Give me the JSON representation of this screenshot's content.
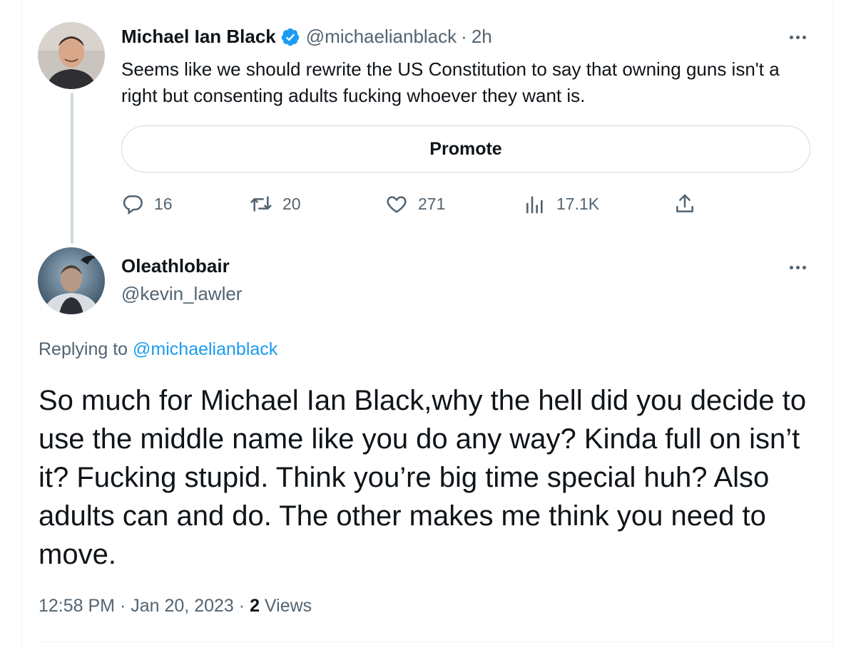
{
  "tweet": {
    "author_name": "Michael Ian Black",
    "author_handle": "@michaelianblack",
    "separator": "·",
    "time_ago": "2h",
    "text": "Seems like we should rewrite the US Constitution to say that owning guns isn't a right but consenting adults fucking whoever they want is.",
    "promote_label": "Promote",
    "stats": {
      "replies": "16",
      "retweets": "20",
      "likes": "271",
      "views": "17.1K"
    },
    "verified": true
  },
  "reply": {
    "author_name": "Oleathlobair",
    "author_handle": "@kevin_lawler",
    "replying_to_label": "Replying to",
    "replying_to_handle": "@michaelianblack",
    "text": "So much for  Michael Ian Black,why the hell did you decide to use the middle name like you do any way? Kinda full on isn’t it? Fucking stupid. Think you’re big time special huh? Also adults can and do. The other makes me think you need to move.",
    "time": "12:58 PM",
    "date": "Jan 20, 2023",
    "views_count": "2",
    "views_label": "Views"
  },
  "colors": {
    "text": "#0f1419",
    "secondary": "#536471",
    "accent": "#1d9bf0",
    "border": "#cfd9de"
  },
  "icons": [
    "verified-badge-icon",
    "more-icon",
    "reply-icon",
    "retweet-icon",
    "like-icon",
    "views-icon",
    "share-icon"
  ]
}
